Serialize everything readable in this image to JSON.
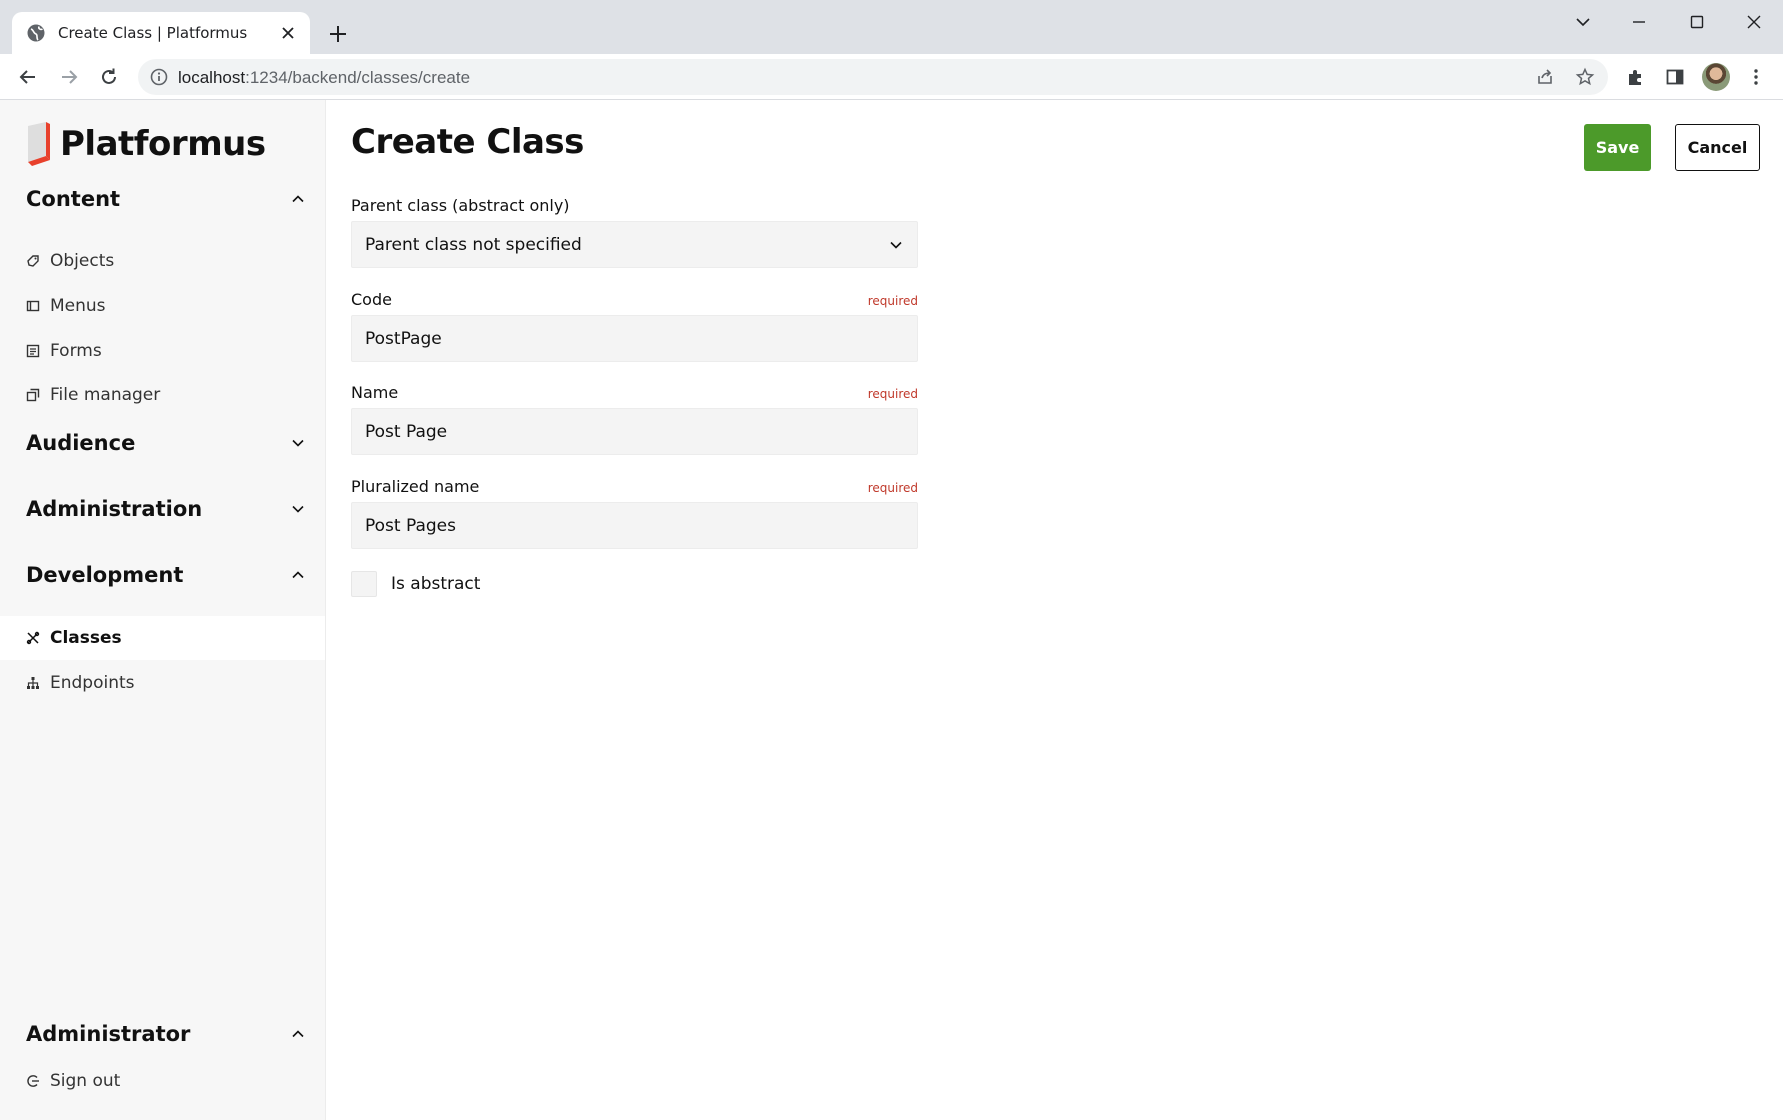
{
  "browser": {
    "tab_title": "Create Class | Platformus",
    "url_host": "localhost",
    "url_path": ":1234/backend/classes/create"
  },
  "brand": {
    "name": "Platformus"
  },
  "sidebar": {
    "sections": [
      {
        "title": "Content",
        "expanded": true,
        "items": [
          {
            "label": "Objects",
            "icon": "objects-icon"
          },
          {
            "label": "Menus",
            "icon": "menus-icon"
          },
          {
            "label": "Forms",
            "icon": "forms-icon"
          },
          {
            "label": "File manager",
            "icon": "file-manager-icon"
          }
        ]
      },
      {
        "title": "Audience",
        "expanded": false,
        "items": []
      },
      {
        "title": "Administration",
        "expanded": false,
        "items": []
      },
      {
        "title": "Development",
        "expanded": true,
        "items": [
          {
            "label": "Classes",
            "icon": "classes-icon",
            "active": true
          },
          {
            "label": "Endpoints",
            "icon": "endpoints-icon"
          }
        ]
      },
      {
        "title": "Administrator",
        "expanded": true,
        "items": [
          {
            "label": "Sign out",
            "icon": "sign-out-icon"
          }
        ]
      }
    ]
  },
  "main": {
    "title": "Create Class",
    "save_label": "Save",
    "cancel_label": "Cancel",
    "fields": {
      "parent_class": {
        "label": "Parent class (abstract only)",
        "value": "Parent class not specified"
      },
      "code": {
        "label": "Code",
        "required": "required",
        "value": "PostPage"
      },
      "name": {
        "label": "Name",
        "required": "required",
        "value": "Post Page"
      },
      "pluralized_name": {
        "label": "Pluralized name",
        "required": "required",
        "value": "Post Pages"
      }
    },
    "is_abstract": {
      "label": "Is abstract",
      "checked": false
    }
  },
  "colors": {
    "save": "#4c9a2a",
    "required": "#c0392b",
    "logo_red": "#e8412c"
  }
}
